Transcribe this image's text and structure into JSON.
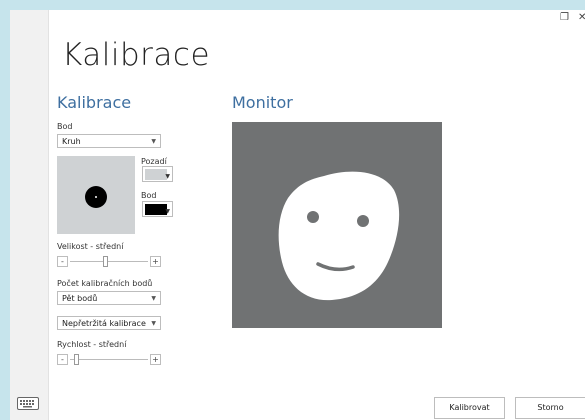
{
  "window": {
    "restore_glyph": "❐",
    "close_glyph": "✕"
  },
  "page": {
    "title": "Kalibrace"
  },
  "left": {
    "section_title": "Kalibrace",
    "bod_label": "Bod",
    "shape_combo": "Kruh",
    "pozadi_label": "Pozadí",
    "pozadi_color": "#cfd2d4",
    "bod_color_label": "Bod",
    "bod_color": "#000000",
    "size_label": "Velikost - střední",
    "size_level": 0.45,
    "count_label": "Počet kalibračních bodů",
    "count_combo": "Pět bodů",
    "mode_combo": "Nepřetržitá kalibrace",
    "speed_label": "Rychlost - střední",
    "speed_level": 0.05
  },
  "monitor": {
    "section_title": "Monitor",
    "background": "#707273",
    "face_color": "#ffffff",
    "feature_color": "#707273"
  },
  "footer": {
    "calibrate_label": "Kalibrovat",
    "cancel_label": "Storno"
  },
  "icons": {
    "keyboard": "keyboard-icon",
    "dropdown": "chevron-down-icon"
  }
}
